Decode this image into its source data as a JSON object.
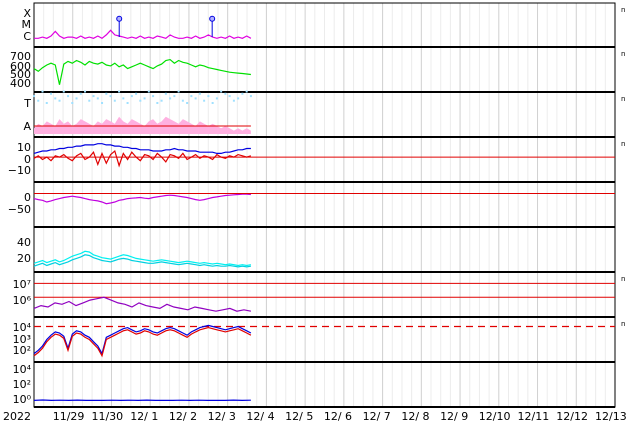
{
  "chart_data": {
    "type": "line",
    "x_tick_labels": [
      "2022",
      "11/29",
      "11/30",
      "12/ 1",
      "12/ 2",
      "12/ 3",
      "12/ 4",
      "12/ 5",
      "12/ 6",
      "12/ 7",
      "12/ 8",
      "12/ 9",
      "12/10",
      "12/11",
      "12/12",
      "12/13"
    ],
    "data_end_day": 5.6,
    "panels": [
      {
        "id": "xray-class",
        "y_tick_labels": [
          "X",
          "M",
          "C"
        ],
        "right_label": "n",
        "series": [
          {
            "color": "#e000e0",
            "style": "line",
            "values": [
              0.3,
              0.3,
              0.4,
              0.3,
              0.5,
              0.9,
              0.5,
              0.3,
              0.4,
              0.4,
              0.3,
              0.5,
              0.3,
              0.4,
              0.3,
              0.5,
              0.3,
              0.6,
              1.0,
              0.6,
              0.5,
              0.4,
              0.3,
              0.4,
              0.3,
              0.5,
              0.3,
              0.4,
              0.3,
              0.5,
              0.4,
              0.3,
              0.6,
              0.4,
              0.3,
              0.3,
              0.4,
              0.3,
              0.5,
              0.3,
              0.4,
              0.6,
              0.4,
              0.3,
              0.4,
              0.3,
              0.5,
              0.3,
              0.4,
              0.3,
              0.5,
              0.3
            ]
          },
          {
            "color": "#0000e0",
            "style": "marker",
            "markers": [
              [
                2.2,
                2.0
              ],
              [
                4.6,
                2.0
              ]
            ]
          }
        ]
      },
      {
        "id": "solar-wind-speed",
        "y_tick_labels": [
          "700",
          "600",
          "500",
          "400"
        ],
        "right_label": "n",
        "series": [
          {
            "color": "#00e000",
            "style": "line",
            "values": [
              560,
              530,
              570,
              600,
              620,
              600,
              380,
              610,
              640,
              620,
              650,
              630,
              600,
              640,
              620,
              610,
              630,
              600,
              590,
              620,
              580,
              600,
              560,
              580,
              600,
              620,
              600,
              580,
              560,
              590,
              610,
              650,
              660,
              620,
              650,
              630,
              620,
              600,
              580,
              600,
              590,
              570,
              560,
              550,
              540,
              530,
              520,
              515,
              510,
              505,
              500,
              495
            ]
          }
        ]
      },
      {
        "id": "ta-index",
        "y_tick_labels": [
          "T",
          "A"
        ],
        "right_label": "n",
        "series": [
          {
            "color": "#a0e0ff",
            "style": "scatter",
            "values": [
              1.8,
              1.6,
              2.0,
              1.5,
              1.9,
              1.7,
              1.6,
              2.0,
              1.8,
              1.5,
              1.7,
              1.9,
              2.0,
              1.6,
              1.8,
              1.7,
              1.5,
              1.9,
              1.8,
              1.6,
              2.0,
              1.7,
              1.5,
              1.8,
              1.9,
              1.6,
              1.7,
              2.0,
              1.8,
              1.5,
              1.6,
              1.9,
              1.7,
              1.8,
              2.0,
              1.6,
              1.5,
              1.8,
              1.7,
              1.9,
              1.6,
              1.8,
              1.5,
              1.7,
              2.0,
              1.9,
              1.8,
              1.6,
              1.7,
              1.9,
              2.0,
              1.8
            ]
          },
          {
            "color": "#ffb0e0",
            "style": "band",
            "values": [
              0.4,
              0.6,
              0.5,
              0.7,
              0.6,
              0.5,
              0.8,
              0.6,
              0.7,
              0.5,
              0.6,
              0.8,
              0.7,
              0.6,
              0.5,
              0.7,
              0.6,
              0.8,
              0.7,
              0.6,
              0.9,
              0.7,
              0.6,
              0.8,
              0.7,
              0.6,
              0.5,
              0.7,
              0.8,
              0.6,
              0.7,
              0.9,
              0.8,
              0.7,
              0.6,
              0.8,
              0.7,
              0.6,
              0.5,
              0.7,
              0.6,
              0.5,
              0.6,
              0.5,
              0.4,
              0.5,
              0.4,
              0.3,
              0.4,
              0.3,
              0.4,
              0.3
            ]
          },
          {
            "color": "#e00000",
            "style": "hline",
            "level": 0.5,
            "until_day": 5.6
          }
        ]
      },
      {
        "id": "imf",
        "y_tick_labels": [
          "10",
          "0",
          "−10"
        ],
        "right_label": "n",
        "y_ticks": [
          10,
          0,
          -10
        ],
        "y_range": [
          -18,
          14
        ],
        "series": [
          {
            "color": "#0000e0",
            "style": "line",
            "values": [
              3,
              4,
              5,
              5,
              6,
              6,
              7,
              7,
              8,
              8,
              9,
              9,
              10,
              10,
              10,
              11,
              11,
              10,
              10,
              9,
              9,
              8,
              8,
              7,
              7,
              6,
              6,
              6,
              5,
              5,
              5,
              6,
              6,
              7,
              6,
              6,
              5,
              5,
              5,
              4,
              4,
              4,
              4,
              3,
              3,
              4,
              4,
              5,
              6,
              6,
              7,
              7
            ]
          },
          {
            "color": "#e00000",
            "style": "line",
            "values": [
              -1,
              1,
              -2,
              0,
              -3,
              1,
              0,
              2,
              -1,
              -3,
              1,
              3,
              -2,
              0,
              4,
              -6,
              3,
              -5,
              2,
              5,
              -7,
              3,
              -2,
              4,
              0,
              -3,
              2,
              1,
              -2,
              3,
              0,
              -4,
              2,
              1,
              -1,
              3,
              -2,
              0,
              2,
              -1,
              1,
              0,
              -2,
              2,
              0,
              -1,
              1,
              0,
              2,
              1,
              0,
              1
            ]
          },
          {
            "color": "#e00000",
            "style": "zero"
          }
        ]
      },
      {
        "id": "dst",
        "y_tick_labels": [
          "0",
          "−50"
        ],
        "y_ticks": [
          0,
          -50
        ],
        "y_range": [
          -90,
          25
        ],
        "series": [
          {
            "color": "#c000e0",
            "style": "line",
            "values": [
              -15,
              -18,
              -20,
              -25,
              -22,
              -18,
              -15,
              -12,
              -10,
              -8,
              -10,
              -12,
              -15,
              -18,
              -20,
              -22,
              -25,
              -30,
              -28,
              -25,
              -20,
              -18,
              -15,
              -14,
              -13,
              -12,
              -14,
              -15,
              -12,
              -10,
              -8,
              -6,
              -5,
              -6,
              -8,
              -10,
              -12,
              -15,
              -18,
              -20,
              -18,
              -15,
              -12,
              -10,
              -8,
              -6,
              -5,
              -4,
              -3,
              -2,
              -2,
              -3
            ]
          },
          {
            "color": "#e00000",
            "style": "zero"
          }
        ]
      },
      {
        "id": "electron-flux",
        "y_tick_labels": [
          "40",
          "20"
        ],
        "y_ticks": [
          40,
          20
        ],
        "y_range": [
          0,
          55
        ],
        "series": [
          {
            "color": "#00f0f0",
            "style": "line",
            "values": [
              8,
              10,
              12,
              9,
              11,
              13,
              10,
              12,
              15,
              18,
              20,
              22,
              25,
              24,
              20,
              18,
              16,
              15,
              14,
              16,
              18,
              20,
              19,
              17,
              15,
              14,
              13,
              12,
              11,
              12,
              13,
              12,
              11,
              10,
              9,
              10,
              11,
              10,
              9,
              8,
              9,
              8,
              7,
              8,
              7,
              6,
              7,
              6,
              5,
              6,
              5,
              6
            ]
          },
          {
            "color": "#00d0e0",
            "style": "line",
            "values": [
              4,
              6,
              8,
              5,
              7,
              9,
              6,
              8,
              10,
              13,
              15,
              17,
              20,
              19,
              16,
              14,
              12,
              11,
              10,
              12,
              14,
              15,
              14,
              12,
              11,
              10,
              9,
              8,
              8,
              9,
              10,
              9,
              8,
              7,
              6,
              7,
              8,
              7,
              6,
              5,
              6,
              5,
              4,
              5,
              4,
              4,
              5,
              4,
              3,
              4,
              3,
              4
            ]
          }
        ]
      },
      {
        "id": "proton-flux",
        "y_tick_labels": [
          "10⁷",
          "10⁶"
        ],
        "right_label": "n",
        "log_range": [
          4.8,
          7.6
        ],
        "series": [
          {
            "color": "#e00000",
            "style": "hline",
            "level": 7.0
          },
          {
            "color": "#e00000",
            "style": "hline",
            "level": 6.0
          },
          {
            "color": "#9000c0",
            "style": "line",
            "values": [
              5.2,
              5.4,
              5.3,
              5.6,
              5.5,
              5.7,
              5.4,
              5.6,
              5.8,
              5.9,
              6.0,
              5.8,
              5.6,
              5.5,
              5.3,
              5.6,
              5.4,
              5.3,
              5.2,
              5.5,
              5.3,
              5.2,
              5.1,
              5.3,
              5.2,
              5.1,
              5.0,
              5.1,
              5.2,
              5.0,
              5.1,
              5.0
            ]
          }
        ]
      },
      {
        "id": "xray-flux",
        "y_tick_labels": [
          "10⁴",
          "10³",
          "10²"
        ],
        "right_label": "n",
        "log_range": [
          1.0,
          4.6
        ],
        "series": [
          {
            "color": "#e00000",
            "style": "dashed",
            "level": 4.0
          },
          {
            "color": "#0000e0",
            "style": "line",
            "values": [
              1.5,
              1.8,
              2.2,
              2.8,
              3.2,
              3.5,
              3.4,
              3.1,
              2.0,
              3.3,
              3.6,
              3.5,
              3.2,
              3.0,
              2.6,
              2.2,
              1.5,
              3.0,
              3.2,
              3.4,
              3.6,
              3.8,
              3.9,
              3.7,
              3.5,
              3.6,
              3.8,
              3.7,
              3.5,
              3.4,
              3.6,
              3.8,
              3.9,
              3.8,
              3.6,
              3.4,
              3.2,
              3.5,
              3.7,
              3.9,
              4.0,
              4.1,
              4.0,
              3.9,
              3.8,
              3.7,
              3.8,
              3.9,
              4.0,
              3.8,
              3.6,
              3.4
            ]
          },
          {
            "color": "#e00000",
            "style": "line",
            "values": [
              1.3,
              1.6,
              2.0,
              2.6,
              3.0,
              3.3,
              3.2,
              2.9,
              1.8,
              3.1,
              3.4,
              3.3,
              3.0,
              2.8,
              2.4,
              2.0,
              1.3,
              2.8,
              3.0,
              3.2,
              3.4,
              3.6,
              3.7,
              3.5,
              3.3,
              3.4,
              3.6,
              3.5,
              3.3,
              3.2,
              3.4,
              3.6,
              3.7,
              3.6,
              3.4,
              3.2,
              3.0,
              3.3,
              3.5,
              3.7,
              3.8,
              3.9,
              3.8,
              3.7,
              3.6,
              3.5,
              3.6,
              3.7,
              3.8,
              3.6,
              3.4,
              3.2
            ]
          }
        ]
      },
      {
        "id": "neutron",
        "y_tick_labels": [
          "10⁴",
          "10²",
          "10⁰"
        ],
        "log_range": [
          -0.8,
          4.6
        ],
        "series": [
          {
            "color": "#0000e0",
            "style": "line",
            "values": [
              -0.3,
              -0.25,
              -0.3,
              -0.28,
              -0.3,
              -0.26,
              -0.3,
              -0.29,
              -0.3,
              -0.27,
              -0.3,
              -0.28,
              -0.3,
              -0.26,
              -0.3,
              -0.29,
              -0.3,
              -0.28,
              -0.3,
              -0.27,
              -0.3,
              -0.29,
              -0.3,
              -0.26,
              -0.3,
              -0.28
            ]
          }
        ]
      }
    ]
  }
}
